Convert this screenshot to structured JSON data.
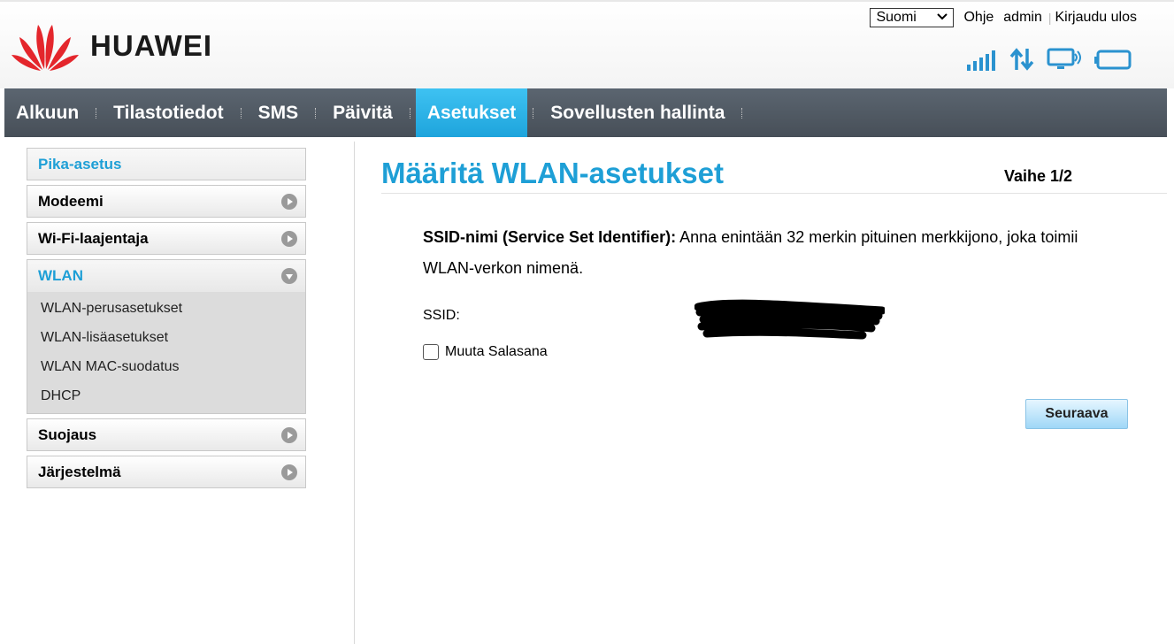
{
  "header": {
    "brand": "HUAWEI",
    "language": "Suomi",
    "links": {
      "help": "Ohje",
      "user": "admin",
      "logout": "Kirjaudu ulos"
    },
    "status_icons": [
      "signal-strength-icon",
      "data-transfer-icon",
      "computer-connection-icon",
      "battery-icon"
    ],
    "accent": "#1e9fd6",
    "logo_color": "#e4262c"
  },
  "nav": {
    "items": [
      {
        "label": "Alkuun",
        "active": false
      },
      {
        "label": "Tilastotiedot",
        "active": false
      },
      {
        "label": "SMS",
        "active": false
      },
      {
        "label": "Päivitä",
        "active": false
      },
      {
        "label": "Asetukset",
        "active": true
      },
      {
        "label": "Sovellusten hallinta",
        "active": false
      }
    ]
  },
  "sidebar": {
    "quick_setup": "Pika-asetus",
    "items": [
      {
        "label": "Modeemi"
      },
      {
        "label": "Wi-Fi-laajentaja"
      }
    ],
    "wlan": {
      "label": "WLAN",
      "sub_items": [
        "WLAN-perusasetukset",
        "WLAN-lisäasetukset",
        "WLAN MAC-suodatus",
        "DHCP"
      ]
    },
    "items_after": [
      {
        "label": "Suojaus"
      },
      {
        "label": "Järjestelmä"
      }
    ]
  },
  "main": {
    "title": "Määritä WLAN-asetukset",
    "step": "Vaihe 1/2",
    "desc_bold": "SSID-nimi (Service Set Identifier):",
    "desc_text": " Anna enintään 32 merkin pituinen merkkijono, joka toimii WLAN-verkon nimenä.",
    "ssid_label": "SSID:",
    "change_password_label": "Muuta Salasana",
    "change_password_checked": false,
    "next_button": "Seuraava"
  }
}
